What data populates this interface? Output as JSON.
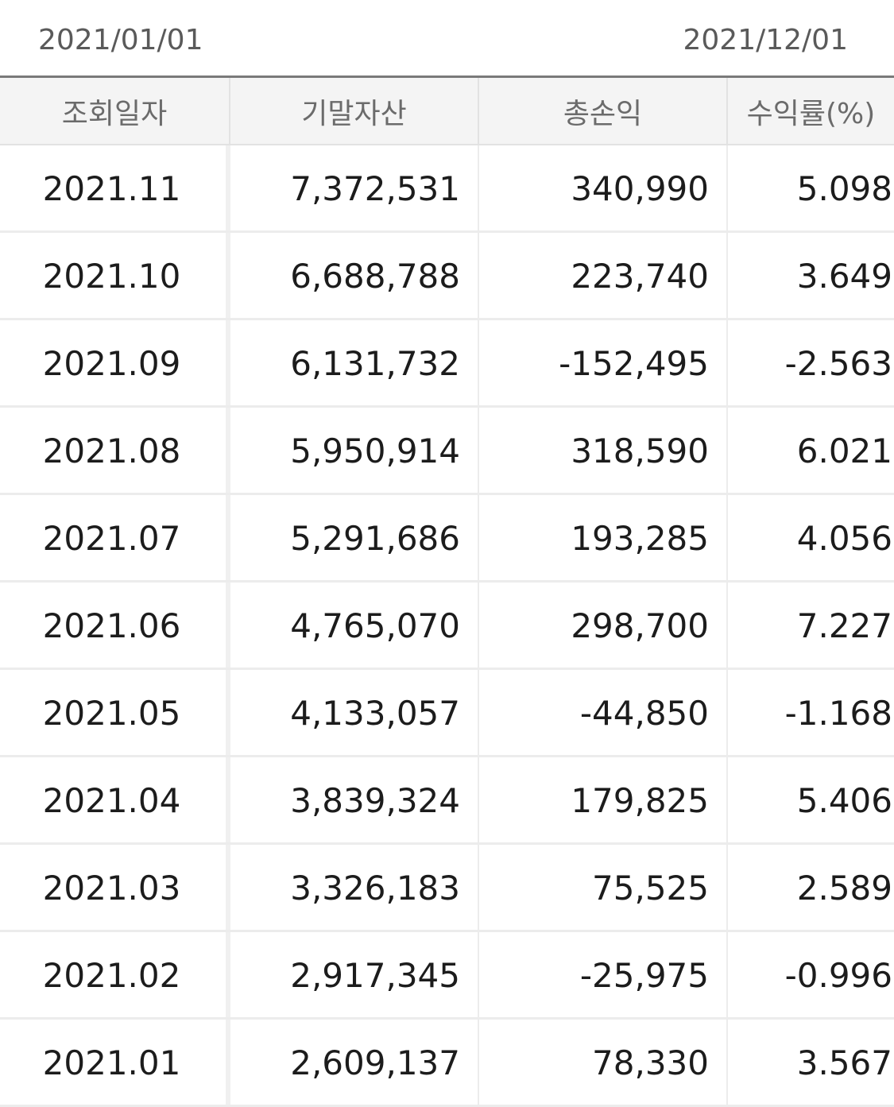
{
  "date_range": {
    "start": "2021/01/01",
    "end": "2021/12/01"
  },
  "table": {
    "headers": [
      "조회일자",
      "기말자산",
      "총손익",
      "수익률(%)"
    ],
    "rows": [
      {
        "date": "2021.11",
        "assets": "7,372,531",
        "profit": "340,990",
        "rate": "5.098",
        "sign": "pos"
      },
      {
        "date": "2021.10",
        "assets": "6,688,788",
        "profit": "223,740",
        "rate": "3.649",
        "sign": "pos"
      },
      {
        "date": "2021.09",
        "assets": "6,131,732",
        "profit": "-152,495",
        "rate": "-2.563",
        "sign": "neg"
      },
      {
        "date": "2021.08",
        "assets": "5,950,914",
        "profit": "318,590",
        "rate": "6.021",
        "sign": "pos"
      },
      {
        "date": "2021.07",
        "assets": "5,291,686",
        "profit": "193,285",
        "rate": "4.056",
        "sign": "pos"
      },
      {
        "date": "2021.06",
        "assets": "4,765,070",
        "profit": "298,700",
        "rate": "7.227",
        "sign": "pos"
      },
      {
        "date": "2021.05",
        "assets": "4,133,057",
        "profit": "-44,850",
        "rate": "-1.168",
        "sign": "neg"
      },
      {
        "date": "2021.04",
        "assets": "3,839,324",
        "profit": "179,825",
        "rate": "5.406",
        "sign": "pos"
      },
      {
        "date": "2021.03",
        "assets": "3,326,183",
        "profit": "75,525",
        "rate": "2.589",
        "sign": "pos"
      },
      {
        "date": "2021.02",
        "assets": "2,917,345",
        "profit": "-25,975",
        "rate": "-0.996",
        "sign": "neg"
      },
      {
        "date": "2021.01",
        "assets": "2,609,137",
        "profit": "78,330",
        "rate": "3.567",
        "sign": "pos"
      }
    ]
  },
  "colors": {
    "positive": "#de3f33",
    "negative": "#3d7ff0"
  }
}
